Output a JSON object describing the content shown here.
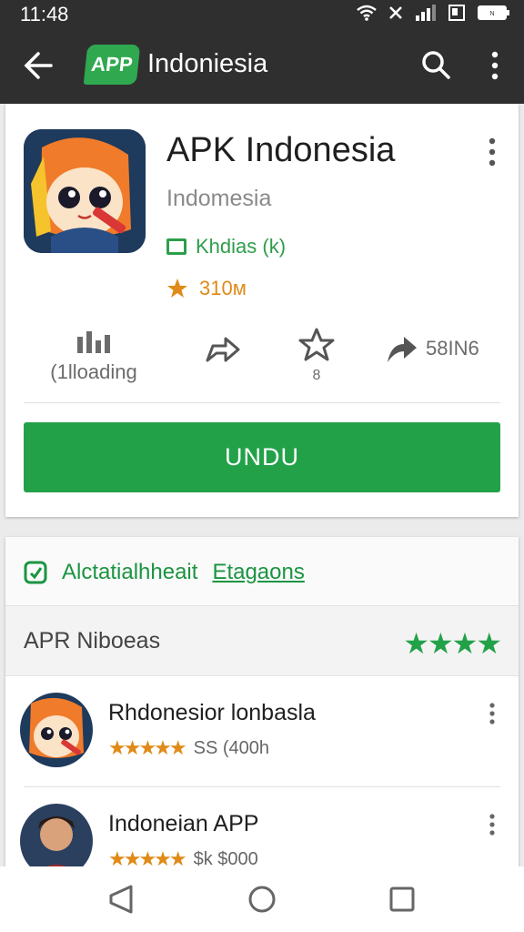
{
  "status": {
    "time": "11:48"
  },
  "appbar": {
    "logo_text": "APP",
    "title": "Indoniesia"
  },
  "app": {
    "name": "APK Indonesia",
    "developer": "Indomesia",
    "category": "Khdias (k)",
    "rating": "310м",
    "stats": [
      {
        "label": "(1lloading"
      },
      {
        "label": ""
      },
      {
        "label": "8"
      },
      {
        "label": "58IN6"
      }
    ],
    "install_label": "UNDU"
  },
  "related": {
    "left": "Alctatialhheait",
    "right": "Etagaons"
  },
  "section": {
    "label": "APR Niboeas",
    "stars": "★★★★"
  },
  "list": [
    {
      "name": "Rhdonesior lonbasla",
      "stars": "★★★★★",
      "meta": "SS (400h"
    },
    {
      "name": "Indoneian APP",
      "stars": "★★★★★",
      "meta": "$k $000"
    }
  ],
  "colors": {
    "accent": "#23a149",
    "bar": "#2f2f2f",
    "star": "#e08a17"
  }
}
